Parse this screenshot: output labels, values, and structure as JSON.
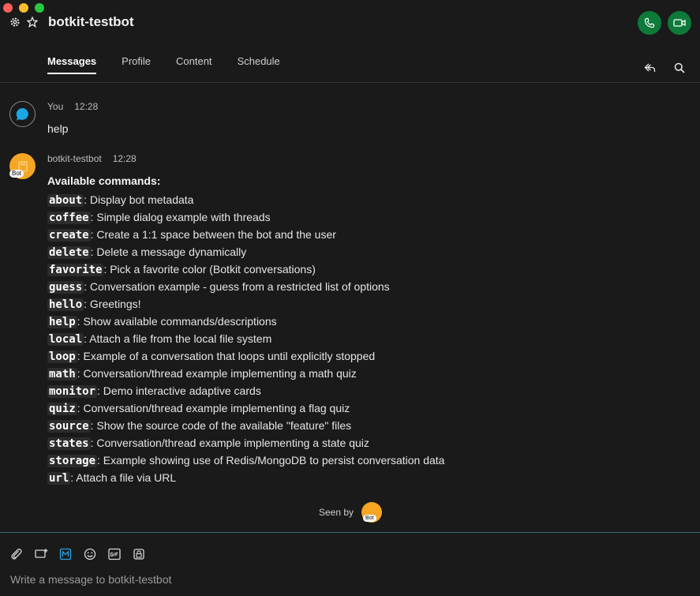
{
  "window": {
    "title": "botkit-testbot"
  },
  "tabs": [
    {
      "label": "Messages",
      "active": true
    },
    {
      "label": "Profile"
    },
    {
      "label": "Content"
    },
    {
      "label": "Schedule"
    }
  ],
  "messages": [
    {
      "sender": "You",
      "time": "12:28",
      "text": "help"
    },
    {
      "sender": "botkit-testbot",
      "time": "12:28",
      "avatar_tag": "Bot",
      "heading": "Available commands:"
    }
  ],
  "commands": [
    {
      "cmd": "about",
      "desc": ": Display bot metadata"
    },
    {
      "cmd": "coffee",
      "desc": ": Simple dialog example with threads"
    },
    {
      "cmd": "create",
      "desc": ": Create a 1:1 space between the bot and the user"
    },
    {
      "cmd": "delete",
      "desc": ": Delete a message dynamically"
    },
    {
      "cmd": "favorite",
      "desc": ": Pick a favorite color (Botkit conversations)"
    },
    {
      "cmd": "guess",
      "desc": ": Conversation example - guess from a restricted list of options"
    },
    {
      "cmd": "hello",
      "desc": ": Greetings!"
    },
    {
      "cmd": "help",
      "desc": ": Show available commands/descriptions"
    },
    {
      "cmd": "local",
      "desc": ": Attach a file from the local file system"
    },
    {
      "cmd": "loop",
      "desc": ": Example of a conversation that loops until explicitly stopped"
    },
    {
      "cmd": "math",
      "desc": ": Conversation/thread example implementing a math quiz"
    },
    {
      "cmd": "monitor",
      "desc": ": Demo interactive adaptive cards"
    },
    {
      "cmd": "quiz",
      "desc": ": Conversation/thread example implementing a flag quiz"
    },
    {
      "cmd": "source",
      "desc": ": Show the source code of the available \"feature\" files"
    },
    {
      "cmd": "states",
      "desc": ": Conversation/thread example implementing a state quiz"
    },
    {
      "cmd": "storage",
      "desc": ": Example showing use of Redis/MongoDB to persist conversation data"
    },
    {
      "cmd": "url",
      "desc": ": Attach a file via URL"
    }
  ],
  "seen": {
    "label": "Seen by",
    "avatar_tag": "Bot"
  },
  "compose": {
    "placeholder": "Write a message to botkit-testbot"
  },
  "icons": {
    "header": [
      "gear-icon",
      "star-icon"
    ],
    "calls": [
      "phone-icon",
      "video-icon"
    ],
    "tab_tools": [
      "share-icon",
      "search-icon"
    ],
    "compose": [
      "attach-icon",
      "whiteboard-icon",
      "markdown-icon",
      "emoji-icon",
      "gif-icon",
      "lock-icon"
    ]
  },
  "colors": {
    "accent_green": "#0d7a3a",
    "bot_avatar": "#f5a623",
    "compose_rule": "#3a6b86"
  }
}
